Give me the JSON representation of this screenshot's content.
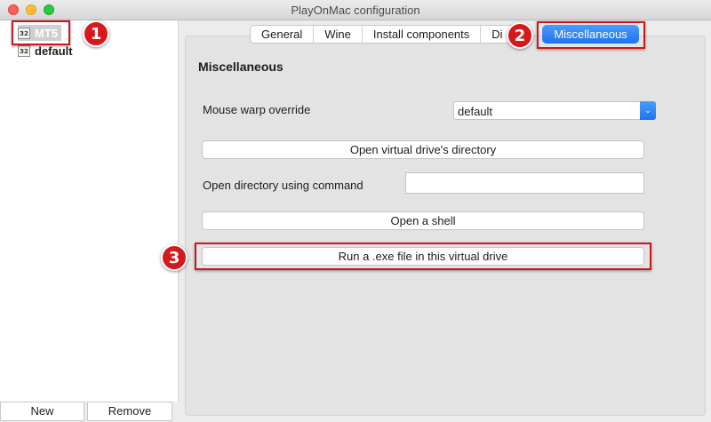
{
  "window": {
    "title": "PlayOnMac configuration"
  },
  "sidebar": {
    "items": [
      {
        "icon_text": "32",
        "label": "MT5"
      },
      {
        "icon_text": "32",
        "label": "default"
      }
    ]
  },
  "bottom_buttons": {
    "new_label": "New",
    "remove_label": "Remove"
  },
  "tabs": {
    "items": [
      "General",
      "Wine",
      "Install components",
      "Di"
    ],
    "active": "Miscellaneous"
  },
  "misc": {
    "section_title": "Miscellaneous",
    "mouse_warp_label": "Mouse warp override",
    "mouse_warp_value": "default",
    "open_dir_button": "Open virtual drive's directory",
    "open_cmd_label": "Open directory using command",
    "open_cmd_value": "",
    "shell_button": "Open a shell",
    "run_exe_button": "Run a .exe file in this virtual drive"
  },
  "annotations": {
    "badge1": "1",
    "badge2": "2",
    "badge3": "3",
    "color": "#d0161a"
  }
}
